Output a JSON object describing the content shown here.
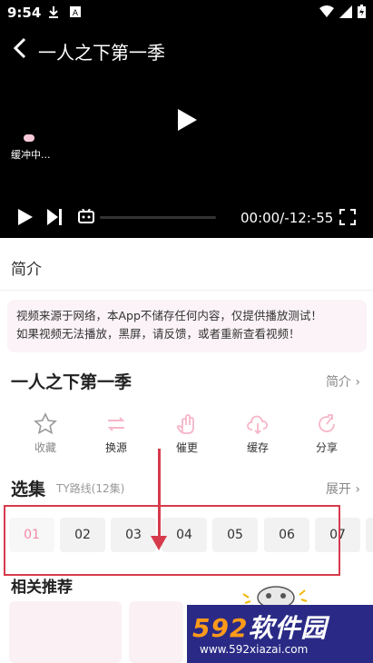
{
  "status_bar": {
    "time": "9:54"
  },
  "player": {
    "title": "一人之下第一季",
    "buffering_text": "缓冲中...",
    "time_display": "00:00/-12:-55"
  },
  "intro": {
    "header": "简介",
    "notice_line1": "视频来源于网络，本App不储存任何内容，仅提供播放测试！",
    "notice_line2": "如果视频无法播放，黑屏，请反馈，或者重新查看视频！"
  },
  "show": {
    "title": "一人之下第一季",
    "intro_link": "简介 ›"
  },
  "actions": [
    {
      "label": "收藏",
      "icon": "star-icon"
    },
    {
      "label": "换源",
      "icon": "switch-source-icon"
    },
    {
      "label": "催更",
      "icon": "hand-icon"
    },
    {
      "label": "缓存",
      "icon": "cloud-download-icon"
    },
    {
      "label": "分享",
      "icon": "share-icon"
    }
  ],
  "episodes_section": {
    "title": "选集",
    "route": "TY路线(12集)",
    "expand": "展开 ›",
    "episodes": [
      "01",
      "02",
      "03",
      "04",
      "05",
      "06",
      "07"
    ],
    "active_index": 0
  },
  "related": {
    "title": "相关推荐"
  },
  "watermark": {
    "brand_num": "592",
    "brand_text": "软件园",
    "url": "www.592xiazai.com"
  },
  "colors": {
    "accent": "#f48aa7",
    "annotation_red": "#d63b4c",
    "watermark_bg": "#2a2a86"
  }
}
